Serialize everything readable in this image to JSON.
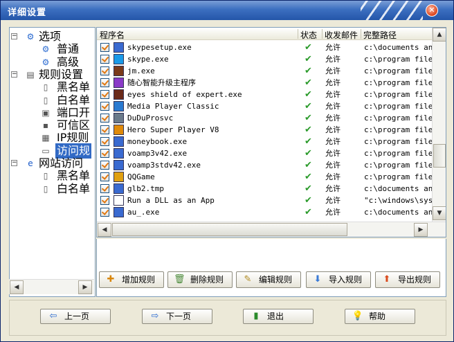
{
  "window": {
    "title": "详细设置"
  },
  "tree": [
    {
      "label": "选项",
      "icon": "gear-globe-icon",
      "expander": "−",
      "level": 0
    },
    {
      "label": "普通",
      "icon": "gear-icon",
      "level": 1
    },
    {
      "label": "高级",
      "icon": "gear-icon",
      "level": 1
    },
    {
      "label": "规则设置",
      "icon": "rules-icon",
      "expander": "−",
      "level": 0
    },
    {
      "label": "黑名单",
      "icon": "document-icon",
      "level": 1
    },
    {
      "label": "白名单",
      "icon": "document-icon",
      "level": 1
    },
    {
      "label": "端口开",
      "icon": "port-icon",
      "level": 1
    },
    {
      "label": "可信区",
      "icon": "network-icon",
      "level": 1
    },
    {
      "label": "IP规则",
      "icon": "ip-rule-icon",
      "level": 1
    },
    {
      "label": "访问规",
      "icon": "exe-icon",
      "level": 1,
      "selected": true
    },
    {
      "label": "网站访问",
      "icon": "browser-icon",
      "expander": "−",
      "level": 0
    },
    {
      "label": "黑名单",
      "icon": "document-icon",
      "level": 1
    },
    {
      "label": "白名单",
      "icon": "document-icon",
      "level": 1
    }
  ],
  "list": {
    "columns": [
      "程序名",
      "状态",
      "收发邮件",
      "完整路径"
    ],
    "rows": [
      {
        "name": "skypesetup.exe",
        "status": "✔",
        "action": "允许",
        "path": "c:\\documents and"
      },
      {
        "name": "skype.exe",
        "status": "✔",
        "action": "允许",
        "path": "c:\\program files"
      },
      {
        "name": "jm.exe",
        "status": "✔",
        "action": "允许",
        "path": "c:\\program files"
      },
      {
        "name": "随心智能升级主程序",
        "status": "✔",
        "action": "允许",
        "path": "c:\\program files"
      },
      {
        "name": "eyes shield of expert.exe",
        "status": "✔",
        "action": "允许",
        "path": "c:\\program files"
      },
      {
        "name": "Media Player Classic",
        "status": "✔",
        "action": "允许",
        "path": "c:\\program files"
      },
      {
        "name": "DuDuProsvc",
        "status": "✔",
        "action": "允许",
        "path": "c:\\program files"
      },
      {
        "name": "Hero Super Player V8",
        "status": "✔",
        "action": "允许",
        "path": "c:\\program files"
      },
      {
        "name": "moneybook.exe",
        "status": "✔",
        "action": "允许",
        "path": "c:\\program files"
      },
      {
        "name": "voamp3v42.exe",
        "status": "✔",
        "action": "允许",
        "path": "c:\\program files"
      },
      {
        "name": "voamp3stdv42.exe",
        "status": "✔",
        "action": "允许",
        "path": "c:\\program files"
      },
      {
        "name": "QQGame",
        "status": "✔",
        "action": "允许",
        "path": "c:\\program files"
      },
      {
        "name": "glb2.tmp",
        "status": "✔",
        "action": "允许",
        "path": "c:\\documents and"
      },
      {
        "name": "Run a DLL as an App",
        "status": "✔",
        "action": "允许",
        "path": "\"c:\\windows\\syst"
      },
      {
        "name": "au_.exe",
        "status": "✔",
        "action": "允许",
        "path": "c:\\documents and"
      }
    ]
  },
  "actions": [
    {
      "label": "增加规则",
      "icon": "plus-icon",
      "glyph": "✚",
      "color": "#d9860c"
    },
    {
      "label": "删除规则",
      "icon": "trash-icon",
      "glyph": "🗑",
      "color": "#4a8a3a"
    },
    {
      "label": "编辑规则",
      "icon": "edit-icon",
      "glyph": "✎",
      "color": "#b08a20"
    },
    {
      "label": "导入规则",
      "icon": "import-icon",
      "glyph": "⬇",
      "color": "#3a7ad6"
    },
    {
      "label": "导出规则",
      "icon": "export-icon",
      "glyph": "⬆",
      "color": "#d94a1c"
    }
  ],
  "nav": [
    {
      "label": "上一页",
      "icon": "arrow-left-icon",
      "glyph": "⇦",
      "color": "#2a6ad0"
    },
    {
      "label": "下一页",
      "icon": "arrow-right-icon",
      "glyph": "⇨",
      "color": "#2a6ad0"
    },
    {
      "label": "退出",
      "icon": "exit-door-icon",
      "glyph": "▮",
      "color": "#2a8a2a"
    },
    {
      "label": "帮助",
      "icon": "lightbulb-icon",
      "glyph": "💡",
      "color": "#e0b020"
    }
  ]
}
